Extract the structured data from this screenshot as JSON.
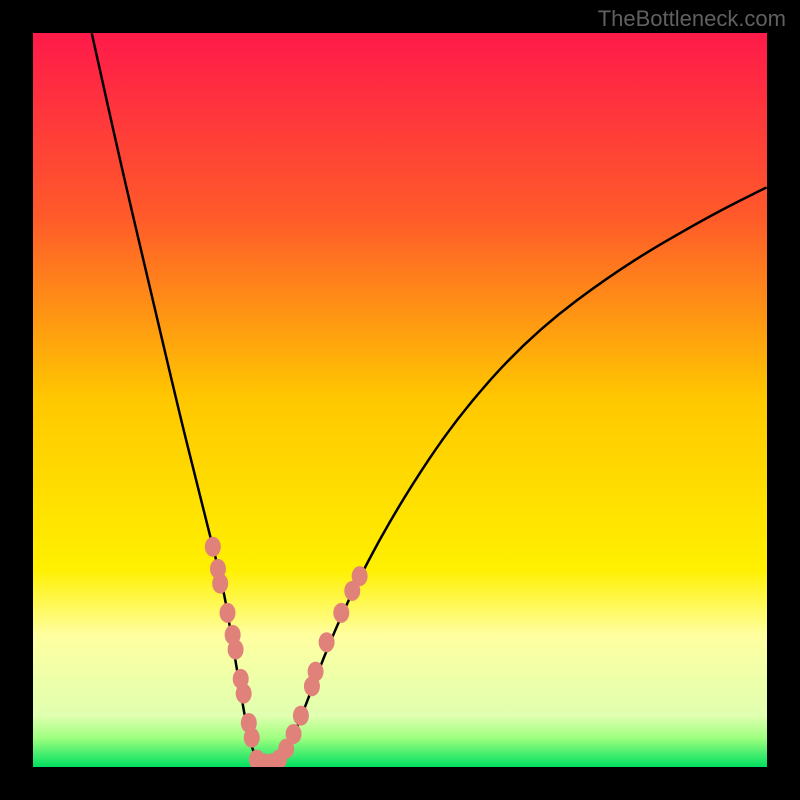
{
  "watermark": "TheBottleneck.com",
  "chart_data": {
    "type": "line",
    "title": "",
    "xlabel": "",
    "ylabel": "",
    "xlim": [
      0,
      100
    ],
    "ylim": [
      0,
      100
    ],
    "gradient_stops": [
      {
        "offset": 0,
        "color": "#ff1a4a"
      },
      {
        "offset": 25,
        "color": "#ff5a2a"
      },
      {
        "offset": 50,
        "color": "#ffc800"
      },
      {
        "offset": 73,
        "color": "#fff000"
      },
      {
        "offset": 82,
        "color": "#ffffa0"
      },
      {
        "offset": 93,
        "color": "#e0ffb0"
      },
      {
        "offset": 96,
        "color": "#a0ff80"
      },
      {
        "offset": 100,
        "color": "#00e060"
      }
    ],
    "series": [
      {
        "name": "curve",
        "type": "line",
        "points": [
          {
            "x": 8,
            "y": 100
          },
          {
            "x": 12,
            "y": 82
          },
          {
            "x": 16,
            "y": 65
          },
          {
            "x": 20,
            "y": 48
          },
          {
            "x": 22,
            "y": 40
          },
          {
            "x": 24,
            "y": 32
          },
          {
            "x": 26,
            "y": 24
          },
          {
            "x": 27,
            "y": 18
          },
          {
            "x": 28,
            "y": 12
          },
          {
            "x": 29,
            "y": 6
          },
          {
            "x": 30,
            "y": 2
          },
          {
            "x": 31,
            "y": 0
          },
          {
            "x": 33,
            "y": 0
          },
          {
            "x": 34,
            "y": 1
          },
          {
            "x": 35,
            "y": 3
          },
          {
            "x": 37,
            "y": 8
          },
          {
            "x": 40,
            "y": 16
          },
          {
            "x": 44,
            "y": 25
          },
          {
            "x": 50,
            "y": 36
          },
          {
            "x": 58,
            "y": 48
          },
          {
            "x": 68,
            "y": 59
          },
          {
            "x": 80,
            "y": 68
          },
          {
            "x": 92,
            "y": 75
          },
          {
            "x": 100,
            "y": 79
          }
        ]
      },
      {
        "name": "dots-left",
        "type": "scatter",
        "points": [
          {
            "x": 24.5,
            "y": 30
          },
          {
            "x": 25.2,
            "y": 27
          },
          {
            "x": 25.5,
            "y": 25
          },
          {
            "x": 26.5,
            "y": 21
          },
          {
            "x": 27.2,
            "y": 18
          },
          {
            "x": 27.6,
            "y": 16
          },
          {
            "x": 28.3,
            "y": 12
          },
          {
            "x": 28.7,
            "y": 10
          },
          {
            "x": 29.4,
            "y": 6
          },
          {
            "x": 29.8,
            "y": 4
          }
        ]
      },
      {
        "name": "dots-bottom",
        "type": "scatter",
        "points": [
          {
            "x": 30.5,
            "y": 1
          },
          {
            "x": 31.5,
            "y": 0.5
          },
          {
            "x": 32.5,
            "y": 0.5
          },
          {
            "x": 33.5,
            "y": 1
          }
        ]
      },
      {
        "name": "dots-right",
        "type": "scatter",
        "points": [
          {
            "x": 34.5,
            "y": 2.5
          },
          {
            "x": 35.5,
            "y": 4.5
          },
          {
            "x": 36.5,
            "y": 7
          },
          {
            "x": 38,
            "y": 11
          },
          {
            "x": 38.5,
            "y": 13
          },
          {
            "x": 40,
            "y": 17
          },
          {
            "x": 42,
            "y": 21
          },
          {
            "x": 43.5,
            "y": 24
          },
          {
            "x": 44.5,
            "y": 26
          }
        ]
      }
    ]
  }
}
